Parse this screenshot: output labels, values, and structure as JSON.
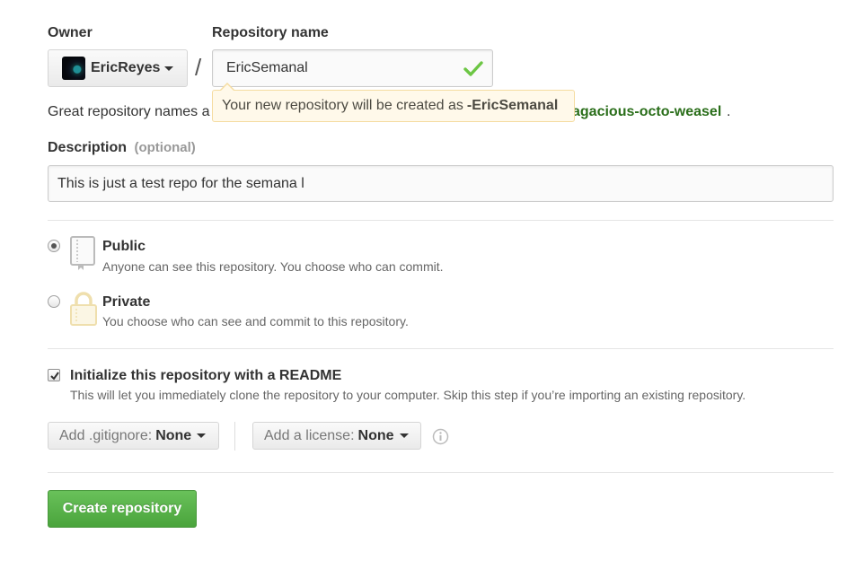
{
  "owner": {
    "label": "Owner",
    "name": "EricReyes",
    "avatar_icon": "user-avatar"
  },
  "repo": {
    "label": "Repository name",
    "value": "EricSemanal",
    "valid_icon": "check-icon",
    "valid_color": "#6cc644"
  },
  "separator": "/",
  "tooltip": {
    "text": "Your new repository will be created as",
    "name": "-EricSemanal"
  },
  "hint": {
    "text": "Great repository names a",
    "suggestion": "agacious-octo-weasel",
    "suffix": "."
  },
  "description": {
    "label": "Description",
    "optional": "(optional)",
    "value": "This is just a test repo for the semana l"
  },
  "visibility": {
    "selected": "public",
    "public": {
      "title": "Public",
      "desc": "Anyone can see this repository. You choose who can commit.",
      "icon": "book-icon"
    },
    "private": {
      "title": "Private",
      "desc": "You choose who can see and commit to this repository.",
      "icon": "lock-icon"
    }
  },
  "readme": {
    "checked": true,
    "title": "Initialize this repository with a README",
    "desc": "This will let you immediately clone the repository to your computer. Skip this step if you’re importing an existing repository."
  },
  "gitignore": {
    "label": "Add .gitignore:",
    "value": "None"
  },
  "license": {
    "label": "Add a license:",
    "value": "None",
    "info_icon": "info-icon"
  },
  "create_button": "Create repository",
  "colors": {
    "accent_green": "#4aa43c",
    "suggestion_green": "#2a6e1a",
    "tooltip_bg": "#fff9ea"
  }
}
